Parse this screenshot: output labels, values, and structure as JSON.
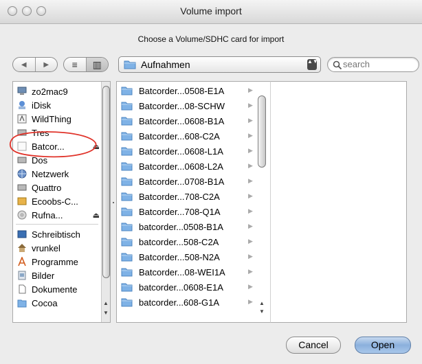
{
  "window": {
    "title": "Volume import"
  },
  "dialog": {
    "prompt": "Choose a Volume/SDHC card for import"
  },
  "toolbar": {
    "nav_back": "◀",
    "nav_forward": "▶",
    "view_list": "≡",
    "view_columns": "▥",
    "location": "Aufnahmen",
    "popup_arrows": "▲▼",
    "search_placeholder": "search"
  },
  "sidebar": {
    "devices": [
      {
        "label": "zo2mac9",
        "icon": "computer-icon",
        "eject": ""
      },
      {
        "label": "iDisk",
        "icon": "idisk-icon",
        "eject": ""
      },
      {
        "label": "WildThing",
        "icon": "external-drive-icon",
        "eject": ""
      },
      {
        "label": "Tres",
        "icon": "drive-icon",
        "eject": ""
      },
      {
        "label": "Batcor...",
        "icon": "sdhc-card-icon",
        "eject": "⏏"
      },
      {
        "label": "Dos",
        "icon": "drive-icon",
        "eject": ""
      },
      {
        "label": "Netzwerk",
        "icon": "network-icon",
        "eject": ""
      },
      {
        "label": "Quattro",
        "icon": "drive-icon",
        "eject": ""
      },
      {
        "label": "Ecoobs-C...",
        "icon": "drive-icon",
        "eject": ""
      },
      {
        "label": "Rufna...",
        "icon": "disc-icon",
        "eject": "⏏"
      }
    ],
    "places": [
      {
        "label": "Schreibtisch",
        "icon": "desktop-icon"
      },
      {
        "label": "vrunkel",
        "icon": "home-icon"
      },
      {
        "label": "Programme",
        "icon": "applications-icon"
      },
      {
        "label": "Bilder",
        "icon": "pictures-icon"
      },
      {
        "label": "Dokumente",
        "icon": "documents-icon"
      },
      {
        "label": "Cocoa",
        "icon": "folder-icon"
      }
    ]
  },
  "browser": {
    "items": [
      "Batcorder...0508-E1A",
      "Batcorder...08-SCHW",
      "Batcorder...0608-B1A",
      "Batcorder...608-C2A",
      "Batcorder...0608-L1A",
      "Batcorder...0608-L2A",
      "Batcorder...0708-B1A",
      "Batcorder...708-C2A",
      "Batcorder...708-Q1A",
      "batcorder...0508-B1A",
      "batcorder...508-C2A",
      "Batcorder...508-N2A",
      "Batcorder...08-WEI1A",
      "batcorder...0608-E1A",
      "batcorder...608-G1A"
    ],
    "row_arrow": "▶"
  },
  "buttons": {
    "cancel": "Cancel",
    "open": "Open"
  },
  "colors": {
    "annotation": "#e0332a",
    "default_button": "#8bb0dd",
    "folder": "#7fb2e6"
  }
}
